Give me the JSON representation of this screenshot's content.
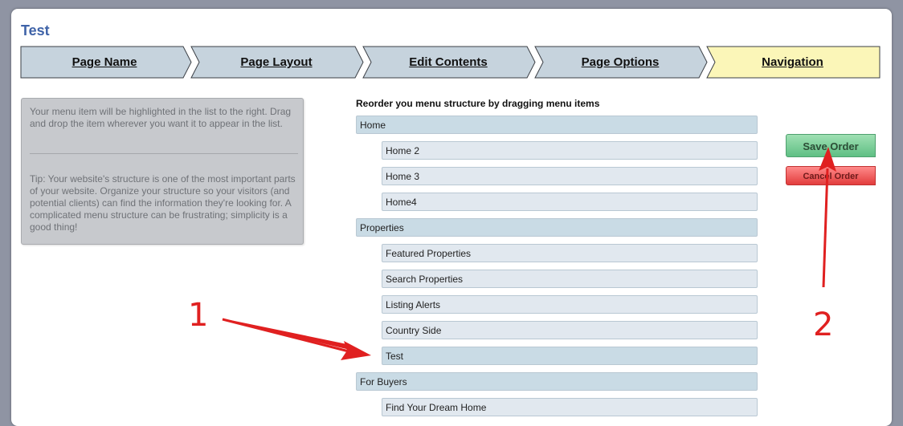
{
  "page": {
    "title": "Test"
  },
  "steps": [
    {
      "label": "Page Name",
      "active": false
    },
    {
      "label": "Page Layout",
      "active": false
    },
    {
      "label": "Edit Contents",
      "active": false
    },
    {
      "label": "Page Options",
      "active": false
    },
    {
      "label": "Navigation",
      "active": true
    }
  ],
  "info": {
    "text": "Your menu item will be highlighted in the list to the right. Drag and drop the item wherever you want it to appear in the list.",
    "tip": "Tip: Your website's structure is one of the most important parts of your website. Organize your structure so your visitors (and potential clients) can find the information they're looking for. A complicated menu structure can be frustrating; simplicity is a good thing!"
  },
  "menu": {
    "heading": "Reorder you menu structure by dragging menu items",
    "items": [
      {
        "label": "Home",
        "level": 0
      },
      {
        "label": "Home 2",
        "level": 1
      },
      {
        "label": "Home 3",
        "level": 1
      },
      {
        "label": "Home4",
        "level": 1
      },
      {
        "label": "Properties",
        "level": 0
      },
      {
        "label": "Featured Properties",
        "level": 1
      },
      {
        "label": "Search Properties",
        "level": 1
      },
      {
        "label": "Listing Alerts",
        "level": 1
      },
      {
        "label": "Country Side",
        "level": 1
      },
      {
        "label": "Test",
        "level": 1,
        "active": true
      },
      {
        "label": "For Buyers",
        "level": 0
      },
      {
        "label": "Find Your Dream Home",
        "level": 1
      }
    ]
  },
  "buttons": {
    "save_label": "Save Order",
    "cancel_label": "Cancel Order"
  },
  "annotations": {
    "num1": "1",
    "num2": "2"
  },
  "colors": {
    "step_fill": "#c6d3dd",
    "step_active_fill": "#fbf6b8",
    "title": "#3f63a8",
    "arrow": "#e02020"
  }
}
